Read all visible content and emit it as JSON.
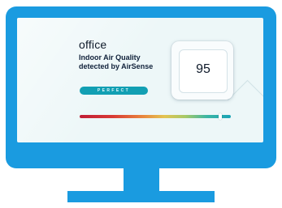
{
  "room": {
    "name": "office",
    "headline": "Indoor Air Quality detected by AirSense",
    "status": "PERFECT"
  },
  "sensor": {
    "score": "95"
  },
  "scale": {
    "level_percent": 93,
    "labels": [
      "",
      "",
      ""
    ]
  },
  "colors": {
    "monitor": "#1a9be0",
    "screen": "#edf7f8",
    "status_pill": "#129fb3"
  }
}
